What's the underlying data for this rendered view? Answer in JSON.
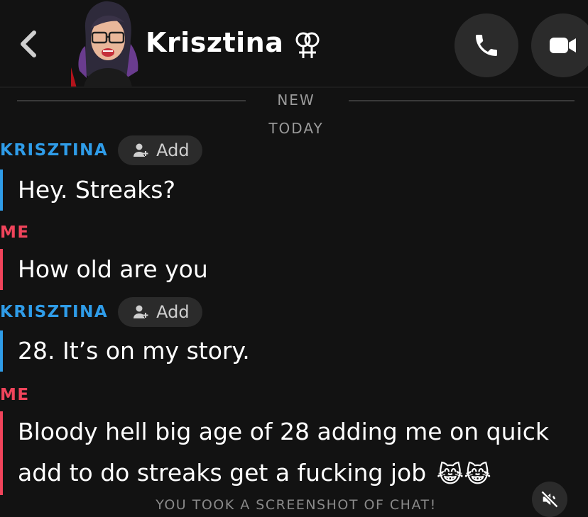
{
  "header": {
    "contact_name": "Krisztina",
    "gender_icon": "female-couple-symbol",
    "back_icon": "chevron-left-icon",
    "call_icon": "phone-icon",
    "video_icon": "video-camera-icon"
  },
  "chat": {
    "new_label": "NEW",
    "today_label": "TODAY",
    "add_label": "Add",
    "messages": [
      {
        "sender": "KRISZTINA",
        "from": "them",
        "show_add": true,
        "lines": [
          "Hey. Streaks?"
        ]
      },
      {
        "sender": "ME",
        "from": "me",
        "show_add": false,
        "lines": [
          "How old are you"
        ]
      },
      {
        "sender": "KRISZTINA",
        "from": "them",
        "show_add": true,
        "lines": [
          "28. It’s on my story."
        ]
      },
      {
        "sender": "ME",
        "from": "me",
        "show_add": false,
        "lines": [
          "Bloody hell big age of 28 adding me on quick",
          "add to do streaks get a fucking job"
        ],
        "emoji": "😹😹"
      }
    ],
    "screenshot_notice": "YOU TOOK A SCREENSHOT OF CHAT!"
  },
  "colors": {
    "them": "#2f9ce8",
    "me": "#f0445b",
    "background": "#121212"
  }
}
